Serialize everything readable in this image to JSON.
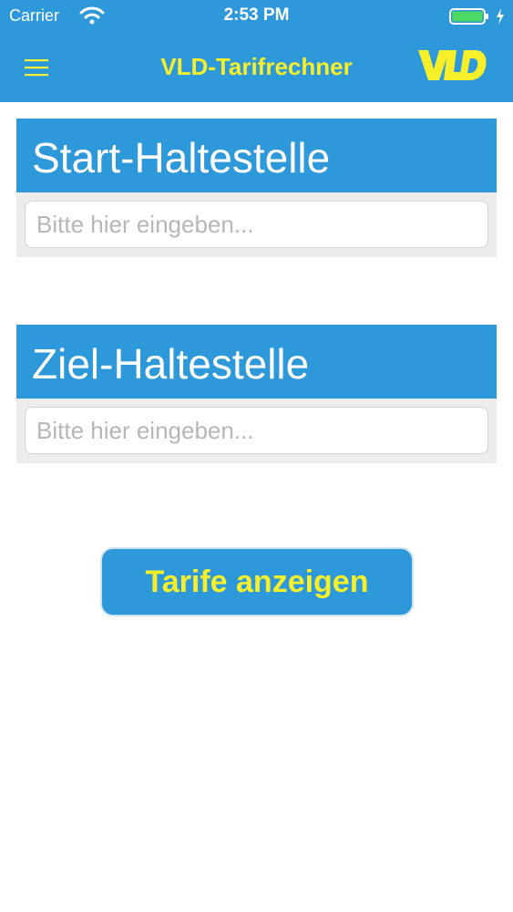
{
  "status_bar": {
    "carrier": "Carrier",
    "time": "2:53 PM",
    "icons": [
      "wifi-icon",
      "battery-icon",
      "charging-icon"
    ]
  },
  "nav": {
    "title": "VLD-Tarifrechner",
    "menu_icon": "hamburger-menu-icon",
    "logo_text": "VLD"
  },
  "start": {
    "title": "Start-Haltestelle",
    "placeholder": "Bitte hier eingeben...",
    "value": ""
  },
  "ziel": {
    "title": "Ziel-Haltestelle",
    "placeholder": "Bitte hier eingeben...",
    "value": ""
  },
  "actions": {
    "submit_label": "Tarife anzeigen"
  },
  "colors": {
    "primary_blue": "#2d98da",
    "accent_yellow": "#f7ef2a",
    "battery_green": "#4cd964",
    "section_background": "#ececec"
  }
}
